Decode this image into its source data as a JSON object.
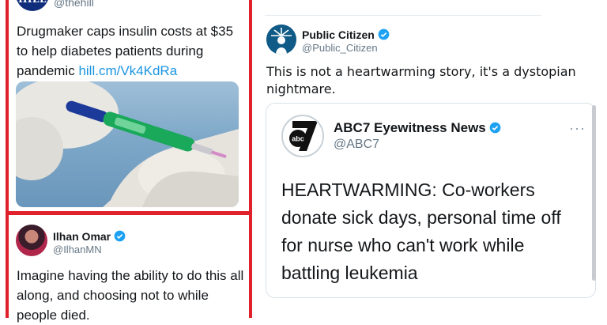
{
  "left": {
    "hill": {
      "logo_text": "HILL",
      "handle": "@thehill",
      "text": "Drugmaker caps insulin costs at $35 to help diabetes patients during pandemic ",
      "link": "hill.cm/Vk4KdRa"
    },
    "omar": {
      "name": "Ilhan Omar",
      "handle": "@IlhanMN",
      "text": "Imagine having the ability to do this all along, and choosing not to while people died."
    }
  },
  "right": {
    "public_citizen": {
      "name": "Public Citizen",
      "handle": "@Public_Citizen",
      "text": "This is not a heartwarming story, it's a dystopian nightmare."
    },
    "quote": {
      "name": "ABC7 Eyewitness News",
      "handle": "@ABC7",
      "logo_text": "abc",
      "text": "HEARTWARMING: Co-workers donate sick days, personal time off for nurse who can't work while battling leukemia"
    }
  },
  "colors": {
    "highlight_border": "#e0202a",
    "verified_blue": "#1da1f2",
    "link_blue": "#1b95e0"
  },
  "icons": [
    "hill-logo",
    "avatar",
    "verified-badge-icon",
    "more-options-icon",
    "abc7-logo"
  ]
}
